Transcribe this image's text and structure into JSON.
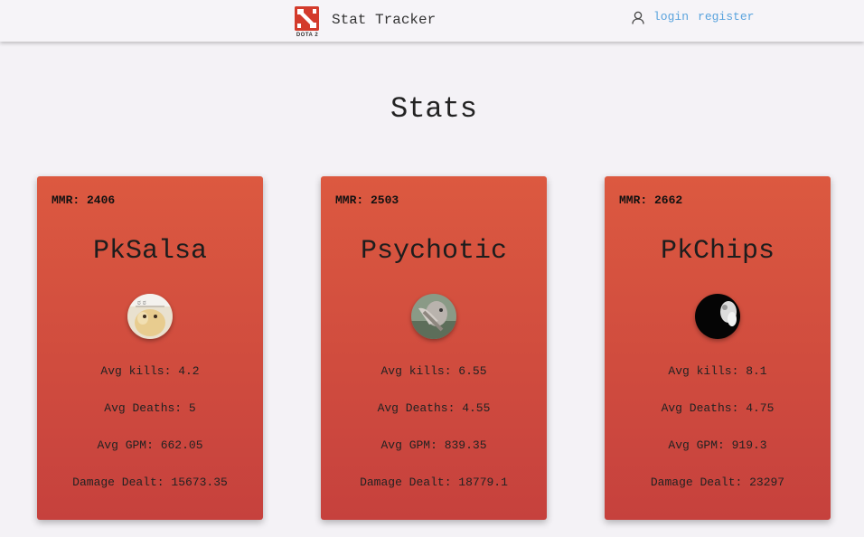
{
  "nav": {
    "logo_text": "DOTA 2",
    "brand": "Stat Tracker",
    "login": "login",
    "register": "register"
  },
  "page": {
    "title": "Stats"
  },
  "players": [
    {
      "mmr": "MMR: 2406",
      "name": "PkSalsa",
      "avg_kills": "Avg kills: 4.2",
      "avg_deaths": "Avg Deaths: 5",
      "avg_gpm": "Avg GPM: 662.05",
      "damage": "Damage Dealt: 15673.35"
    },
    {
      "mmr": "MMR: 2503",
      "name": "Psychotic",
      "avg_kills": "Avg kills: 6.55",
      "avg_deaths": "Avg Deaths: 4.55",
      "avg_gpm": "Avg GPM: 839.35",
      "damage": "Damage Dealt: 18779.1"
    },
    {
      "mmr": "MMR: 2662",
      "name": "PkChips",
      "avg_kills": "Avg kills: 8.1",
      "avg_deaths": "Avg Deaths: 4.75",
      "avg_gpm": "Avg GPM: 919.3",
      "damage": "Damage Dealt: 23297"
    }
  ],
  "colors": {
    "card_top": "#dc5940",
    "card_bottom": "#c6413d",
    "link": "#5aa3dd",
    "logo": "#d33b2c"
  },
  "icons": {
    "logo": "dota2-logo",
    "user": "user-icon"
  }
}
